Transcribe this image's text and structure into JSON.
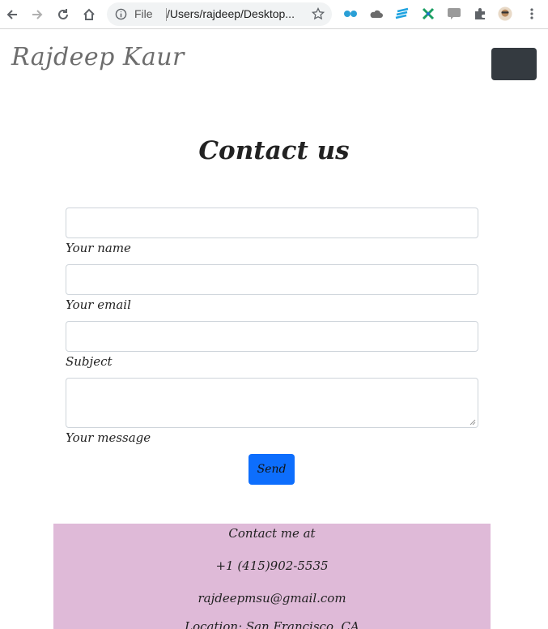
{
  "browser": {
    "omnibox_scheme": "File",
    "omnibox_url": "/Users/rajdeep/Desktop..."
  },
  "site": {
    "brand": "Rajdeep Kaur",
    "title": "Contact us"
  },
  "form": {
    "fields": [
      {
        "label": "Your name",
        "value": ""
      },
      {
        "label": "Your email",
        "value": ""
      },
      {
        "label": "Subject",
        "value": ""
      },
      {
        "label": "Your message",
        "value": ""
      }
    ],
    "send_label": "Send"
  },
  "contact": {
    "heading": "Contact me at",
    "phone": "+1 (415)902-5535",
    "email": "rajdeepmsu@gmail.com",
    "location": "Location: San Francisco, CA"
  },
  "colors": {
    "menu_button": "#343a40",
    "send_button": "#0d6efd",
    "contact_background": "#dfbad8"
  }
}
